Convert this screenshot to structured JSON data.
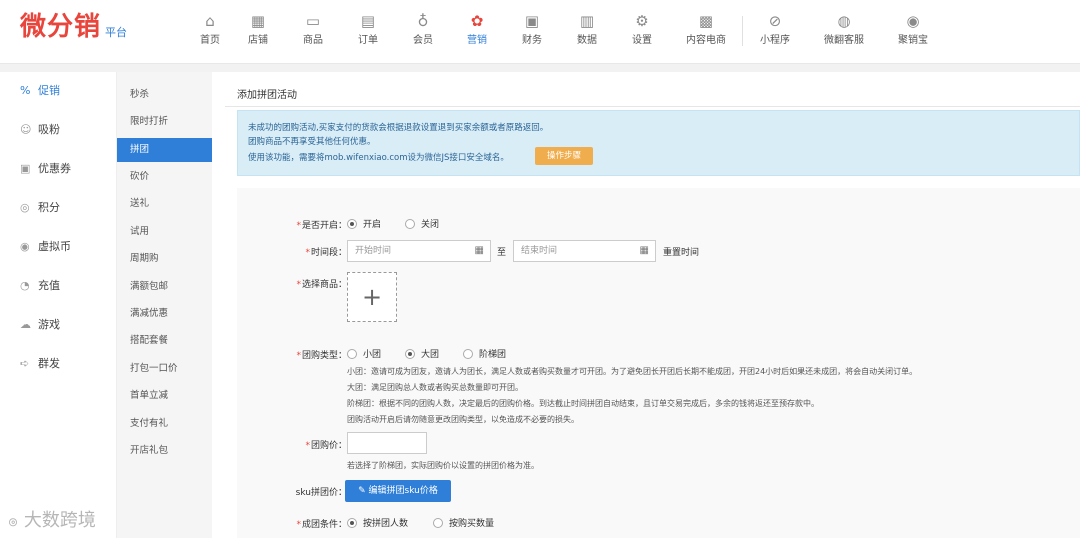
{
  "brand": {
    "logo": "微分销",
    "sub": "平台"
  },
  "topnav": [
    {
      "label": "首页",
      "icon": "⌂"
    },
    {
      "label": "店铺",
      "icon": "▦"
    },
    {
      "label": "商品",
      "icon": "▭"
    },
    {
      "label": "订单",
      "icon": "▤"
    },
    {
      "label": "会员",
      "icon": "♁"
    },
    {
      "label": "营销",
      "icon": "✿"
    },
    {
      "label": "财务",
      "icon": "▣"
    },
    {
      "label": "数据",
      "icon": "▥"
    },
    {
      "label": "设置",
      "icon": "⚙"
    },
    {
      "label": "内容电商",
      "icon": "▩"
    },
    {
      "label": "小程序",
      "icon": "⊘"
    },
    {
      "label": "微翻客服",
      "icon": "◍"
    },
    {
      "label": "聚销宝",
      "icon": "◉"
    }
  ],
  "active_nav": "营销",
  "sidebar1": [
    {
      "label": "促销",
      "icon": "%"
    },
    {
      "label": "吸粉",
      "icon": "☺"
    },
    {
      "label": "优惠券",
      "icon": "▣"
    },
    {
      "label": "积分",
      "icon": "◎"
    },
    {
      "label": "虚拟币",
      "icon": "◉"
    },
    {
      "label": "充值",
      "icon": "◔"
    },
    {
      "label": "游戏",
      "icon": "☁"
    },
    {
      "label": "群发",
      "icon": "➪"
    }
  ],
  "sidebar2": [
    "秒杀",
    "限时打折",
    "拼团",
    "砍价",
    "送礼",
    "试用",
    "周期购",
    "满额包邮",
    "满减优惠",
    "搭配套餐",
    "打包一口价",
    "首单立减",
    "支付有礼",
    "开店礼包"
  ],
  "active_sub": "拼团",
  "page_title": "添加拼团活动",
  "notice": {
    "line1": "未成功的团购活动,买家支付的货款会根据退款设置退到买家余额或者原路返回。",
    "line2": "团购商品不再享受其他任何优惠。",
    "line3": "使用该功能，需要将mob.wifenxiao.com设为微信JS接口安全域名。",
    "btn": "操作步骤"
  },
  "form": {
    "open_label": "是否开启：",
    "open_on": "开启",
    "open_off": "关闭",
    "time_label": "时间段：",
    "start_ph": "开始时间",
    "to": "至",
    "end_ph": "结束时间",
    "reset": "重置时间",
    "goods_label": "选择商品：",
    "type_label": "团购类型：",
    "type_small": "小团",
    "type_big": "大团",
    "type_ladder": "阶梯团",
    "desc1": "小团：邀请可成为团友，邀请人为团长，满足人数或者购买数量才可开团。为了避免团长开团后长期不能成团，开团24小时后如果还未成团，将会自动关闭订单。",
    "desc2": "大团：满足团购总人数或者购买总数量即可开团。",
    "desc3": "阶梯团：根据不同的团购人数，决定最后的团购价格。到达截止时间拼团自动结束，且订单交易完成后，多余的钱将返还至预存款中。",
    "desc4": "团购活动开启后请勿随意更改团购类型，以免造成不必要的损失。",
    "price_label": "团购价：",
    "price_hint": "若选择了阶梯团，实际团购价以设置的拼团价格为准。",
    "sku_label": "sku拼团价：",
    "sku_btn": "编辑拼团sku价格",
    "cond_label": "成团条件：",
    "cond_people": "按拼团人数",
    "cond_qty": "按购买数量"
  },
  "watermark": "大数跨境",
  "colors": {
    "primary": "#2f7fd8",
    "brand": "#e8453c",
    "warning": "#f0ad4e",
    "info_bg": "#d9edf7"
  }
}
